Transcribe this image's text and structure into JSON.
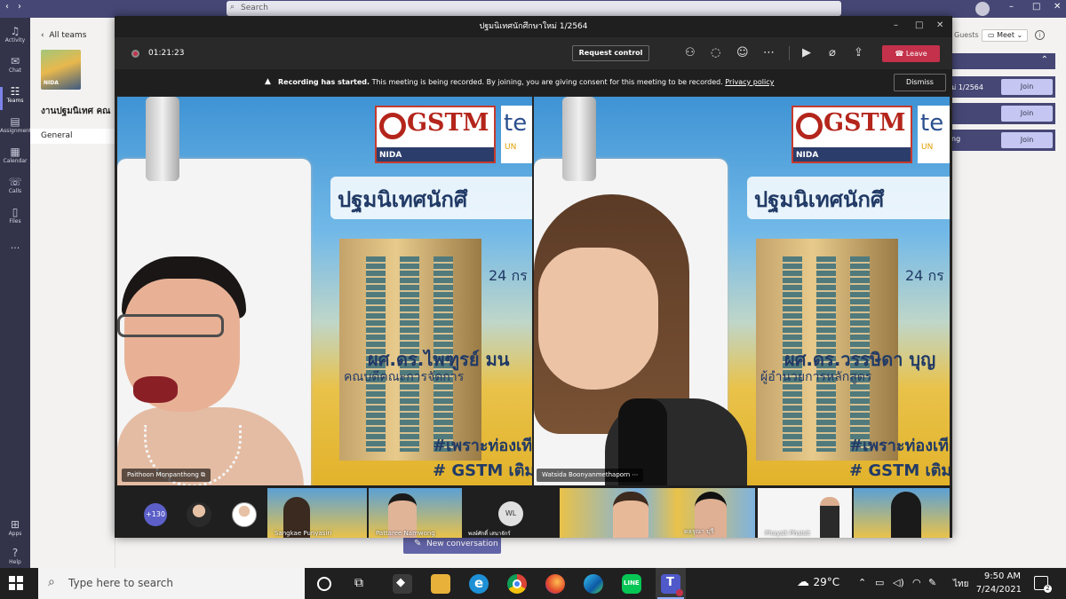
{
  "topbar": {
    "search_placeholder": "Search"
  },
  "rail": [
    {
      "label": "Activity",
      "icon": "bell-icon"
    },
    {
      "label": "Chat",
      "icon": "chat-icon"
    },
    {
      "label": "Teams",
      "icon": "teams-icon"
    },
    {
      "label": "Assignments",
      "icon": "assignments-icon"
    },
    {
      "label": "Calendar",
      "icon": "calendar-icon"
    },
    {
      "label": "Calls",
      "icon": "phone-icon"
    },
    {
      "label": "Files",
      "icon": "file-icon"
    },
    {
      "label": "...",
      "icon": "more-icon"
    },
    {
      "label": "Apps",
      "icon": "apps-icon"
    },
    {
      "label": "Help",
      "icon": "help-icon"
    }
  ],
  "teams_panel": {
    "back_label": "All teams",
    "logo_text": "NIDA",
    "team_name": "งานปฐมนิเทศ คณ",
    "channel": "General"
  },
  "right_pane": {
    "guests_label": "Guests",
    "meet_label": "Meet",
    "rows": [
      {
        "label": "ม่ 1/2564",
        "join": "Join"
      },
      {
        "label": "",
        "join": "Join"
      },
      {
        "label": "ng",
        "join": "Join"
      }
    ]
  },
  "new_conversation": "New conversation",
  "meeting": {
    "title": "ปฐมนิเทศนักศึกษาใหม่ 1/2564",
    "timer": "01:21:23",
    "request_control": "Request control",
    "leave_label": "Leave",
    "banner": {
      "bold": "Recording has started.",
      "text": " This meeting is being recorded. By joining, you are giving consent for this meeting to be recorded. ",
      "link": "Privacy policy",
      "dismiss": "Dismiss"
    },
    "slide": {
      "logo": "GSTM",
      "logo_sub": "NIDA",
      "te_logo": "te",
      "te_sub": "UN",
      "title": "ปฐมนิเทศนักศึ",
      "date": "24 กร",
      "hashtag1": "#เพราะท่องเที",
      "hashtag2": "# GSTM เติม"
    },
    "video_left": {
      "speaker_name": "ผศ.ดร.ไพฑูรย์ มน",
      "speaker_role": "คณบดีคณะการจัดการ",
      "name_chip": "Paithoon Monpanthong"
    },
    "video_right": {
      "speaker_name": "ผศ.ดร.วรรษิดา บุญ",
      "speaker_role": "ผู้อำนวยการหลักสูตร",
      "name_chip": "Watsida Boonyanmethaporn"
    },
    "strip": {
      "overflow_count": "+130",
      "tile1_label": "Sangkae Punyasiri",
      "tile2_label": "Pattaree Namwong",
      "wl_initials": "WL",
      "wl_name": "พงษ์ศักดิ์ เสนาจักร์",
      "tile4_label": "ดลรุณา บุรี",
      "tile5_label": "Phaysit Phaisit"
    }
  },
  "taskbar": {
    "search_placeholder": "Type here to search",
    "weather": "29°C",
    "language": "ไทย",
    "time": "9:50 AM",
    "date": "7/24/2021",
    "notification_count": "2"
  }
}
